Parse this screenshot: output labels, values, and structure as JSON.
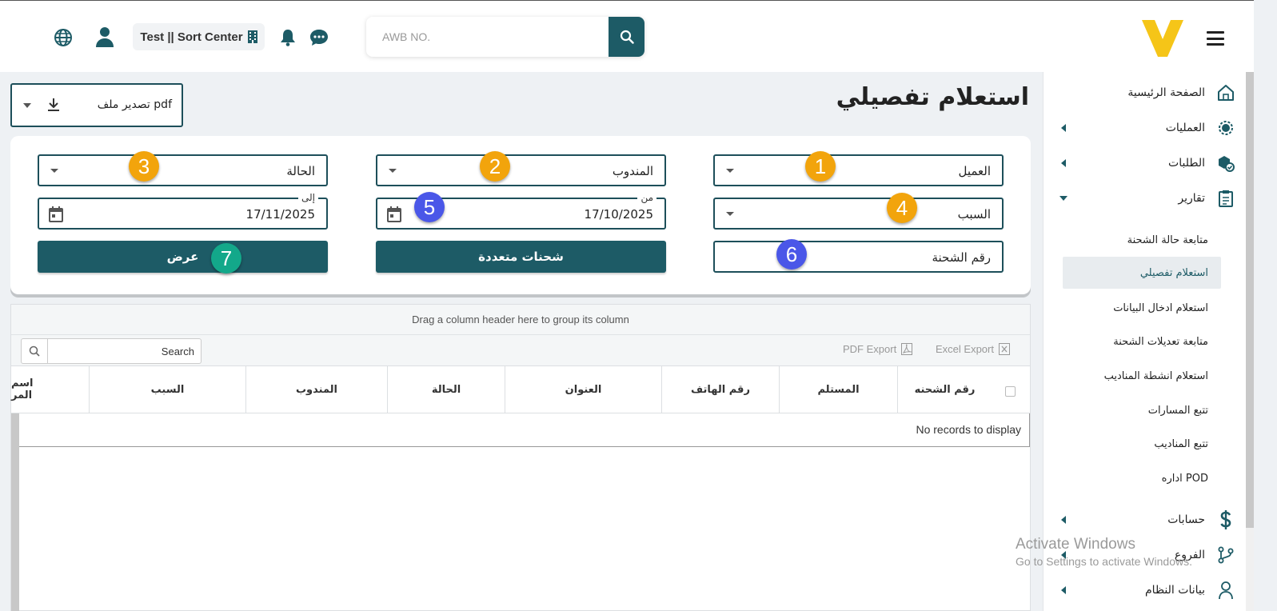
{
  "header": {
    "search_placeholder": "AWB NO.",
    "branch": "Test || Sort Center"
  },
  "page": {
    "title": "استعلام تفصيلي",
    "export_label": "تصدير ملف pdf"
  },
  "filters": {
    "customer": "العميل",
    "courier": "المندوب",
    "status": "الحالة",
    "reason": "السبب",
    "from_label": "من",
    "from_date": "17/10/2025",
    "to_label": "إلى",
    "to_date": "17/11/2025",
    "shipment_no": "رقم الشحنة",
    "multi_shipments": "شحنات متعددة",
    "show": "عرض"
  },
  "badges": [
    "1",
    "2",
    "3",
    "4",
    "5",
    "6",
    "7"
  ],
  "grid": {
    "group_hint": "Drag a column header here to group its column",
    "search_placeholder": "Search",
    "pdf_export": "PDF Export",
    "excel_export": "Excel Export",
    "columns": [
      "رقم الشحنه",
      "المستلم",
      "رقم الهاتف",
      "العنوان",
      "الحالة",
      "المندوب",
      "السبب",
      "اسم المر"
    ],
    "empty": "No records to display"
  },
  "sidebar": {
    "items": [
      {
        "label": "الصفحة الرئيسية",
        "icon": "home-icon"
      },
      {
        "label": "العمليات",
        "icon": "operations-icon"
      },
      {
        "label": "الطلبات",
        "icon": "orders-icon"
      },
      {
        "label": "تقارير",
        "icon": "reports-icon"
      },
      {
        "label": "حسابات",
        "icon": "dollar-icon"
      },
      {
        "label": "الفروع",
        "icon": "branches-icon"
      },
      {
        "label": "بيانات النظام",
        "icon": "user-icon"
      }
    ],
    "sub_items": [
      "متابعة حالة الشحنة",
      "استعلام تفصيلي",
      "استعلام ادخال البيانات",
      "متابعة تعديلات الشحنة",
      "استعلام انشطة المناديب",
      "تتبع المسارات",
      "تتبع المناديب",
      "اداره POD"
    ]
  },
  "watermark": {
    "line1": "Activate Windows",
    "line2": "Go to Settings to activate Windows."
  },
  "colors": {
    "primary": "#1d5b66",
    "logo": "#f5c518",
    "badge_orange": "#f2a40c",
    "badge_blue": "#4a57e8",
    "badge_green": "#13a88a"
  }
}
